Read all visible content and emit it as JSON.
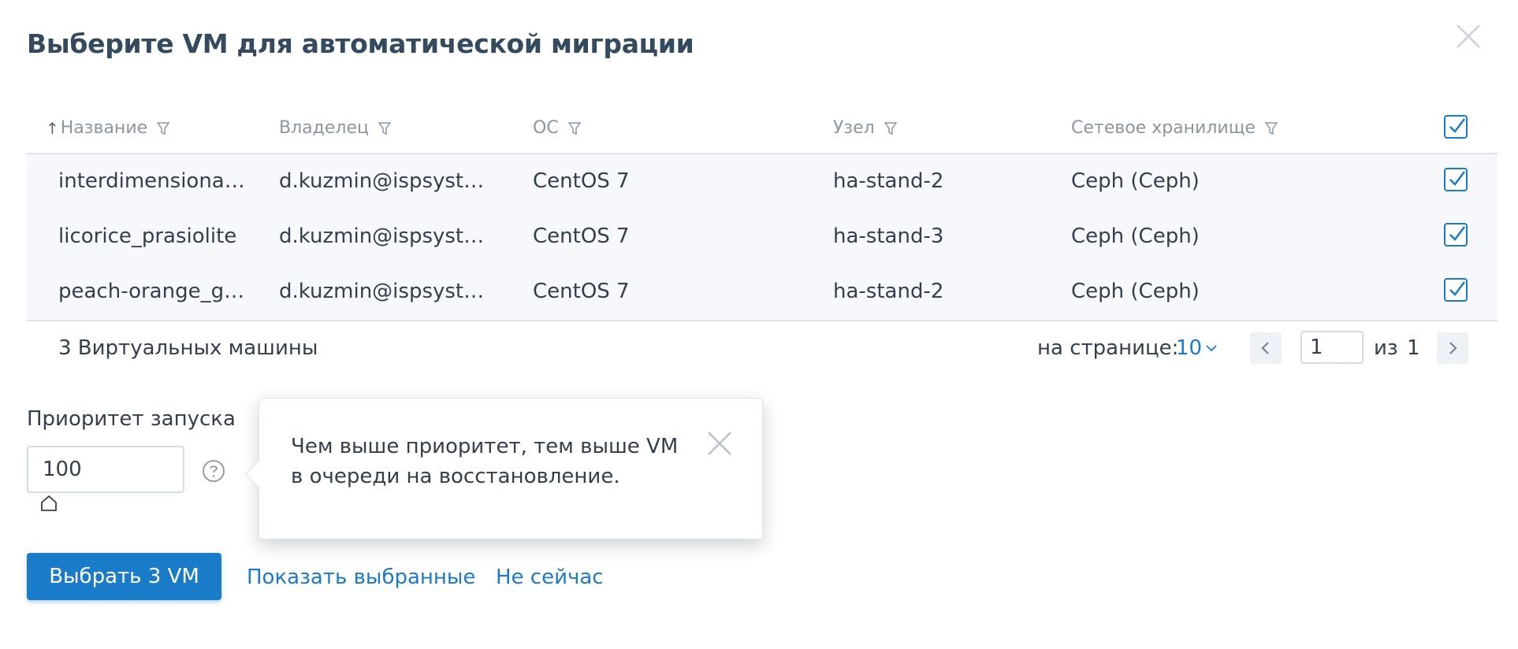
{
  "dialog": {
    "title": "Выберите VM для автоматической миграции"
  },
  "table": {
    "sort_indicator": "↑",
    "columns": [
      {
        "label": "Название"
      },
      {
        "label": "Владелец"
      },
      {
        "label": "ОС"
      },
      {
        "label": "Узел"
      },
      {
        "label": "Сетевое хранилище"
      }
    ],
    "select_all_checked": true,
    "rows": [
      {
        "name": "interdimensiona…",
        "owner": "d.kuzmin@ispsyste…",
        "os": "CentOS 7",
        "node": "ha-stand-2",
        "storage": "Ceph (Ceph)",
        "checked": true
      },
      {
        "name": "licorice_prasiolite",
        "owner": "d.kuzmin@ispsyste…",
        "os": "CentOS 7",
        "node": "ha-stand-3",
        "storage": "Ceph (Ceph)",
        "checked": true
      },
      {
        "name": "peach-orange_g…",
        "owner": "d.kuzmin@ispsyste…",
        "os": "CentOS 7",
        "node": "ha-stand-2",
        "storage": "Ceph (Ceph)",
        "checked": true
      }
    ],
    "footer": {
      "count_label": "3 Виртуальных машины",
      "per_page_label": "на странице:",
      "per_page_value": "10",
      "page_current": "1",
      "page_of_label": "из",
      "page_total": "1"
    }
  },
  "priority": {
    "label": "Приоритет запуска",
    "value": "100"
  },
  "tooltip": {
    "text": "Чем выше приоритет, тем выше VM в очереди на восстановление."
  },
  "actions": {
    "primary_label": "Выбрать 3 VM",
    "show_selected_label": "Показать выбранные",
    "not_now_label": "Не сейчас"
  },
  "colors": {
    "accent": "#1a7bc9",
    "title": "#344a5e",
    "header_text": "#8b96a3",
    "row_bg": "#f6f8fc"
  }
}
